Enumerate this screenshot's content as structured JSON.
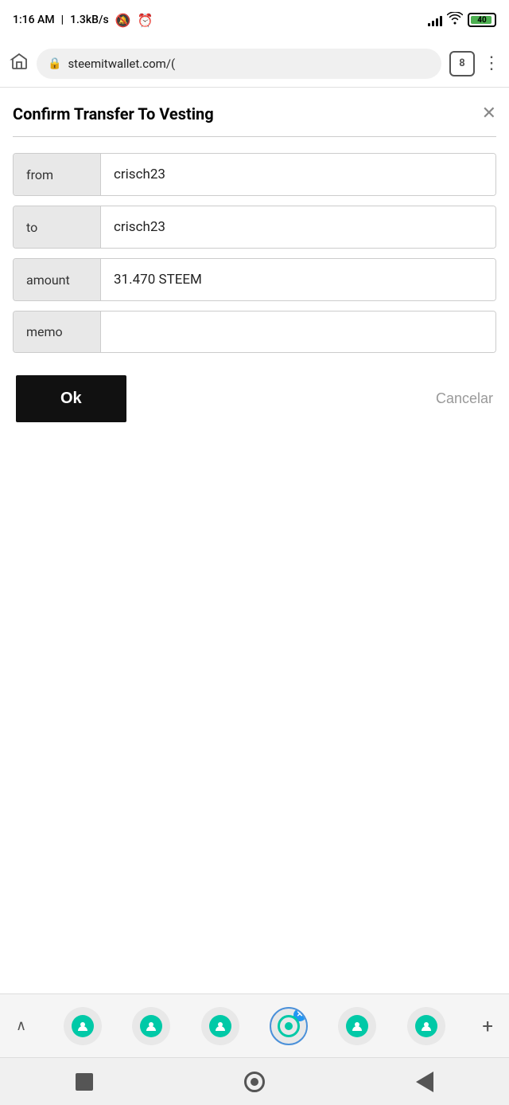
{
  "statusBar": {
    "time": "1:16 AM",
    "speed": "1.3kB/s"
  },
  "browserBar": {
    "url": "steemitwallet.com/(",
    "tabCount": "8"
  },
  "dialog": {
    "title": "Confirm Transfer To Vesting",
    "fields": [
      {
        "label": "from",
        "value": "crisch23"
      },
      {
        "label": "to",
        "value": "crisch23"
      },
      {
        "label": "amount",
        "value": "31.470 STEEM"
      },
      {
        "label": "memo",
        "value": ""
      }
    ],
    "okLabel": "Ok",
    "cancelLabel": "Cancelar"
  }
}
